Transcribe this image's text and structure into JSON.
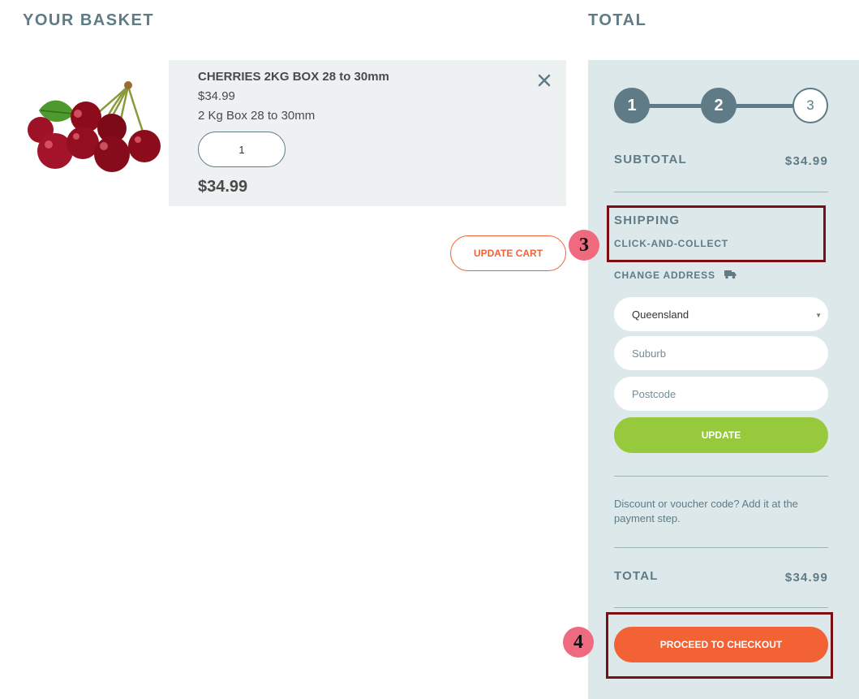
{
  "basket": {
    "heading": "YOUR BASKET",
    "item": {
      "image": "cherries-photo",
      "name": "CHERRIES 2KG BOX 28 to 30mm",
      "price": "$34.99",
      "description": "2 Kg Box 28 to 30mm",
      "quantity": "1",
      "line_total": "$34.99",
      "remove_icon": "close-icon"
    },
    "update_cart_label": "UPDATE CART"
  },
  "summary": {
    "heading": "TOTAL",
    "steps": [
      "1",
      "2",
      "3"
    ],
    "subtotal_label": "SUBTOTAL",
    "subtotal_value": "$34.99",
    "shipping_label": "SHIPPING",
    "shipping_method": "CLICK-AND-COLLECT",
    "change_address_label": "CHANGE ADDRESS",
    "change_address_icon": "truck-icon",
    "state_value": "Queensland",
    "suburb_placeholder": "Suburb",
    "postcode_placeholder": "Postcode",
    "update_label": "UPDATE",
    "voucher_text": "Discount or voucher code? Add it at the payment step.",
    "total_label": "TOTAL",
    "total_value": "$34.99",
    "checkout_label": "PROCEED TO CHECKOUT"
  },
  "annotations": [
    "3",
    "4"
  ],
  "colors": {
    "accent_orange": "#f26234",
    "accent_green": "#97c93d",
    "slate": "#5e7b86",
    "panel_bg": "#dde8ea",
    "annotation_box": "#7a1016",
    "annotation_badge": "#ef6a7e"
  }
}
